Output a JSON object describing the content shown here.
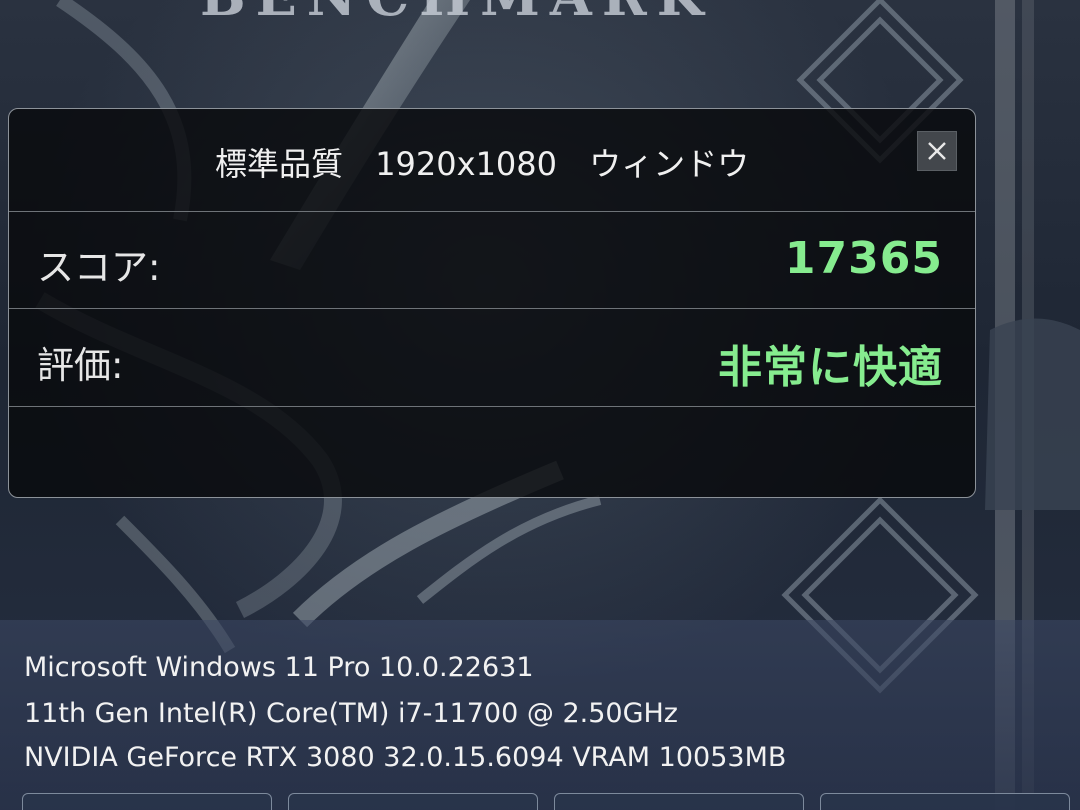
{
  "app": {
    "title_partial": "BENCHMARK"
  },
  "result_dialog": {
    "quality": "標準品質",
    "resolution": "1920x1080",
    "mode": "ウィンドウ",
    "score_label": "スコア:",
    "score_value": "17365",
    "rating_label": "評価:",
    "rating_value": "非常に快適"
  },
  "system_info": {
    "os": "Microsoft Windows 11 Pro 10.0.22631",
    "cpu": "11th Gen Intel(R) Core(TM) i7-11700 @ 2.50GHz",
    "gpu": "NVIDIA GeForce RTX 3080 32.0.15.6094 VRAM 10053MB"
  },
  "icons": {
    "close": "close-icon"
  },
  "colors": {
    "accent_green": "#86ec8f",
    "dialog_bg": "#080a0c",
    "border": "#8c9299"
  }
}
